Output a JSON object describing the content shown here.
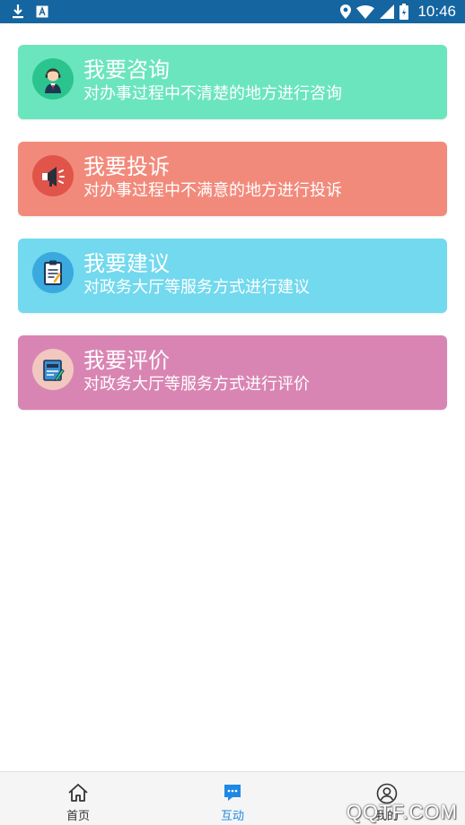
{
  "status_bar": {
    "time": "10:46",
    "icons": [
      "download-icon",
      "app-notification-icon",
      "location-icon",
      "wifi-icon",
      "signal-icon",
      "battery-icon"
    ]
  },
  "cards": [
    {
      "title": "我要咨询",
      "subtitle": "对办事过程中不清楚的地方进行咨询",
      "color": "#6be5bd",
      "icon": "consultant-icon"
    },
    {
      "title": "我要投诉",
      "subtitle": "对办事过程中不满意的地方进行投诉",
      "color": "#f28a7b",
      "icon": "megaphone-icon"
    },
    {
      "title": "我要建议",
      "subtitle": "对政务大厅等服务方式进行建议",
      "color": "#72d9ee",
      "icon": "clipboard-icon"
    },
    {
      "title": "我要评价",
      "subtitle": "对政务大厅等服务方式进行评价",
      "color": "#d985b3",
      "icon": "rating-note-icon"
    }
  ],
  "bottom_nav": {
    "items": [
      {
        "label": "首页",
        "icon": "home-icon"
      },
      {
        "label": "互动",
        "icon": "chat-bubble-icon",
        "active": true
      },
      {
        "label": "我的",
        "icon": "user-icon"
      }
    ],
    "active_color": "#1e88e5"
  },
  "watermark": "QQTF.COM"
}
